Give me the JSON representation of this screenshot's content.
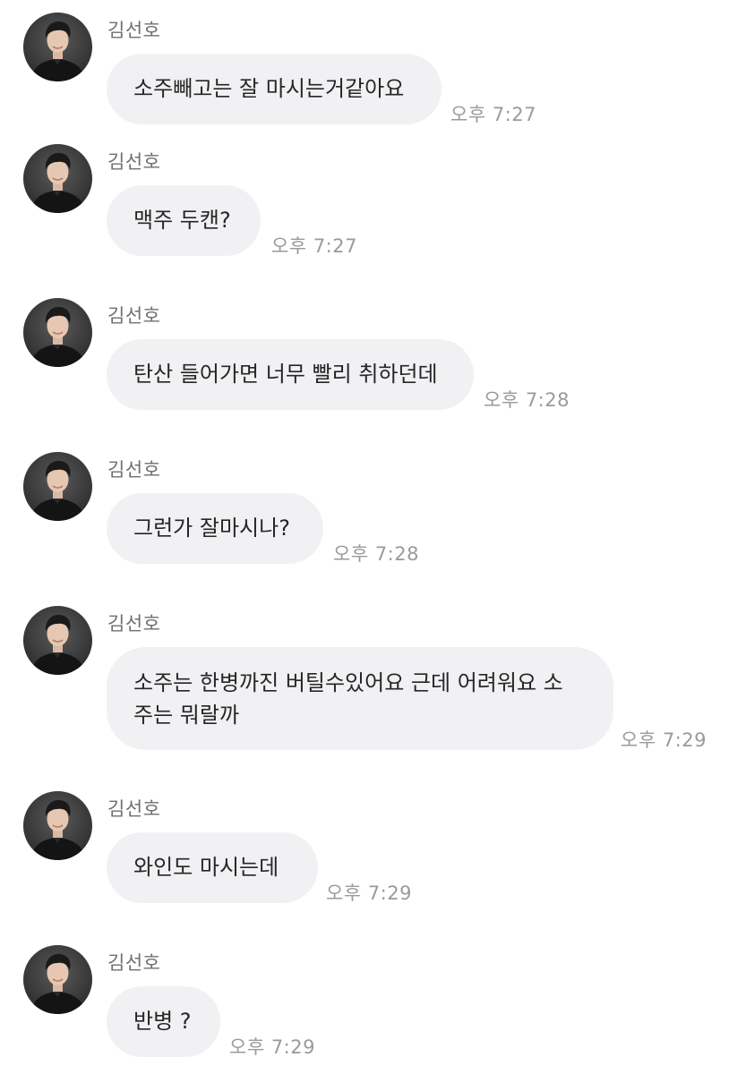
{
  "conversation": {
    "messages": [
      {
        "sender": "김선호",
        "text": "소주빼고는 잘 마시는거같아요",
        "time": "오후 7:27"
      },
      {
        "sender": "김선호",
        "text": "맥주 두캔?",
        "time": "오후 7:27"
      },
      {
        "sender": "김선호",
        "text": "탄산 들어가면 너무 빨리 취하던데",
        "time": "오후 7:28"
      },
      {
        "sender": "김선호",
        "text": "그런가 잘마시나?",
        "time": "오후 7:28"
      },
      {
        "sender": "김선호",
        "text_line1": "소주는 한병까진 버틸수있어요 근데  어려워요 소",
        "text_line2": "주는 뭐랄까",
        "time": "오후 7:29"
      },
      {
        "sender": "김선호",
        "text": "와인도 마시는데",
        "time": "오후 7:29"
      },
      {
        "sender": "김선호",
        "text": "반병 ?",
        "time": "오후 7:29"
      }
    ]
  },
  "colors": {
    "bubble_bg": "#f1f1f4",
    "message_text": "#262626",
    "sender_text": "#6f6f6f",
    "time_text": "#9a9a9a"
  },
  "icons": {
    "avatar": "profile-photo"
  }
}
